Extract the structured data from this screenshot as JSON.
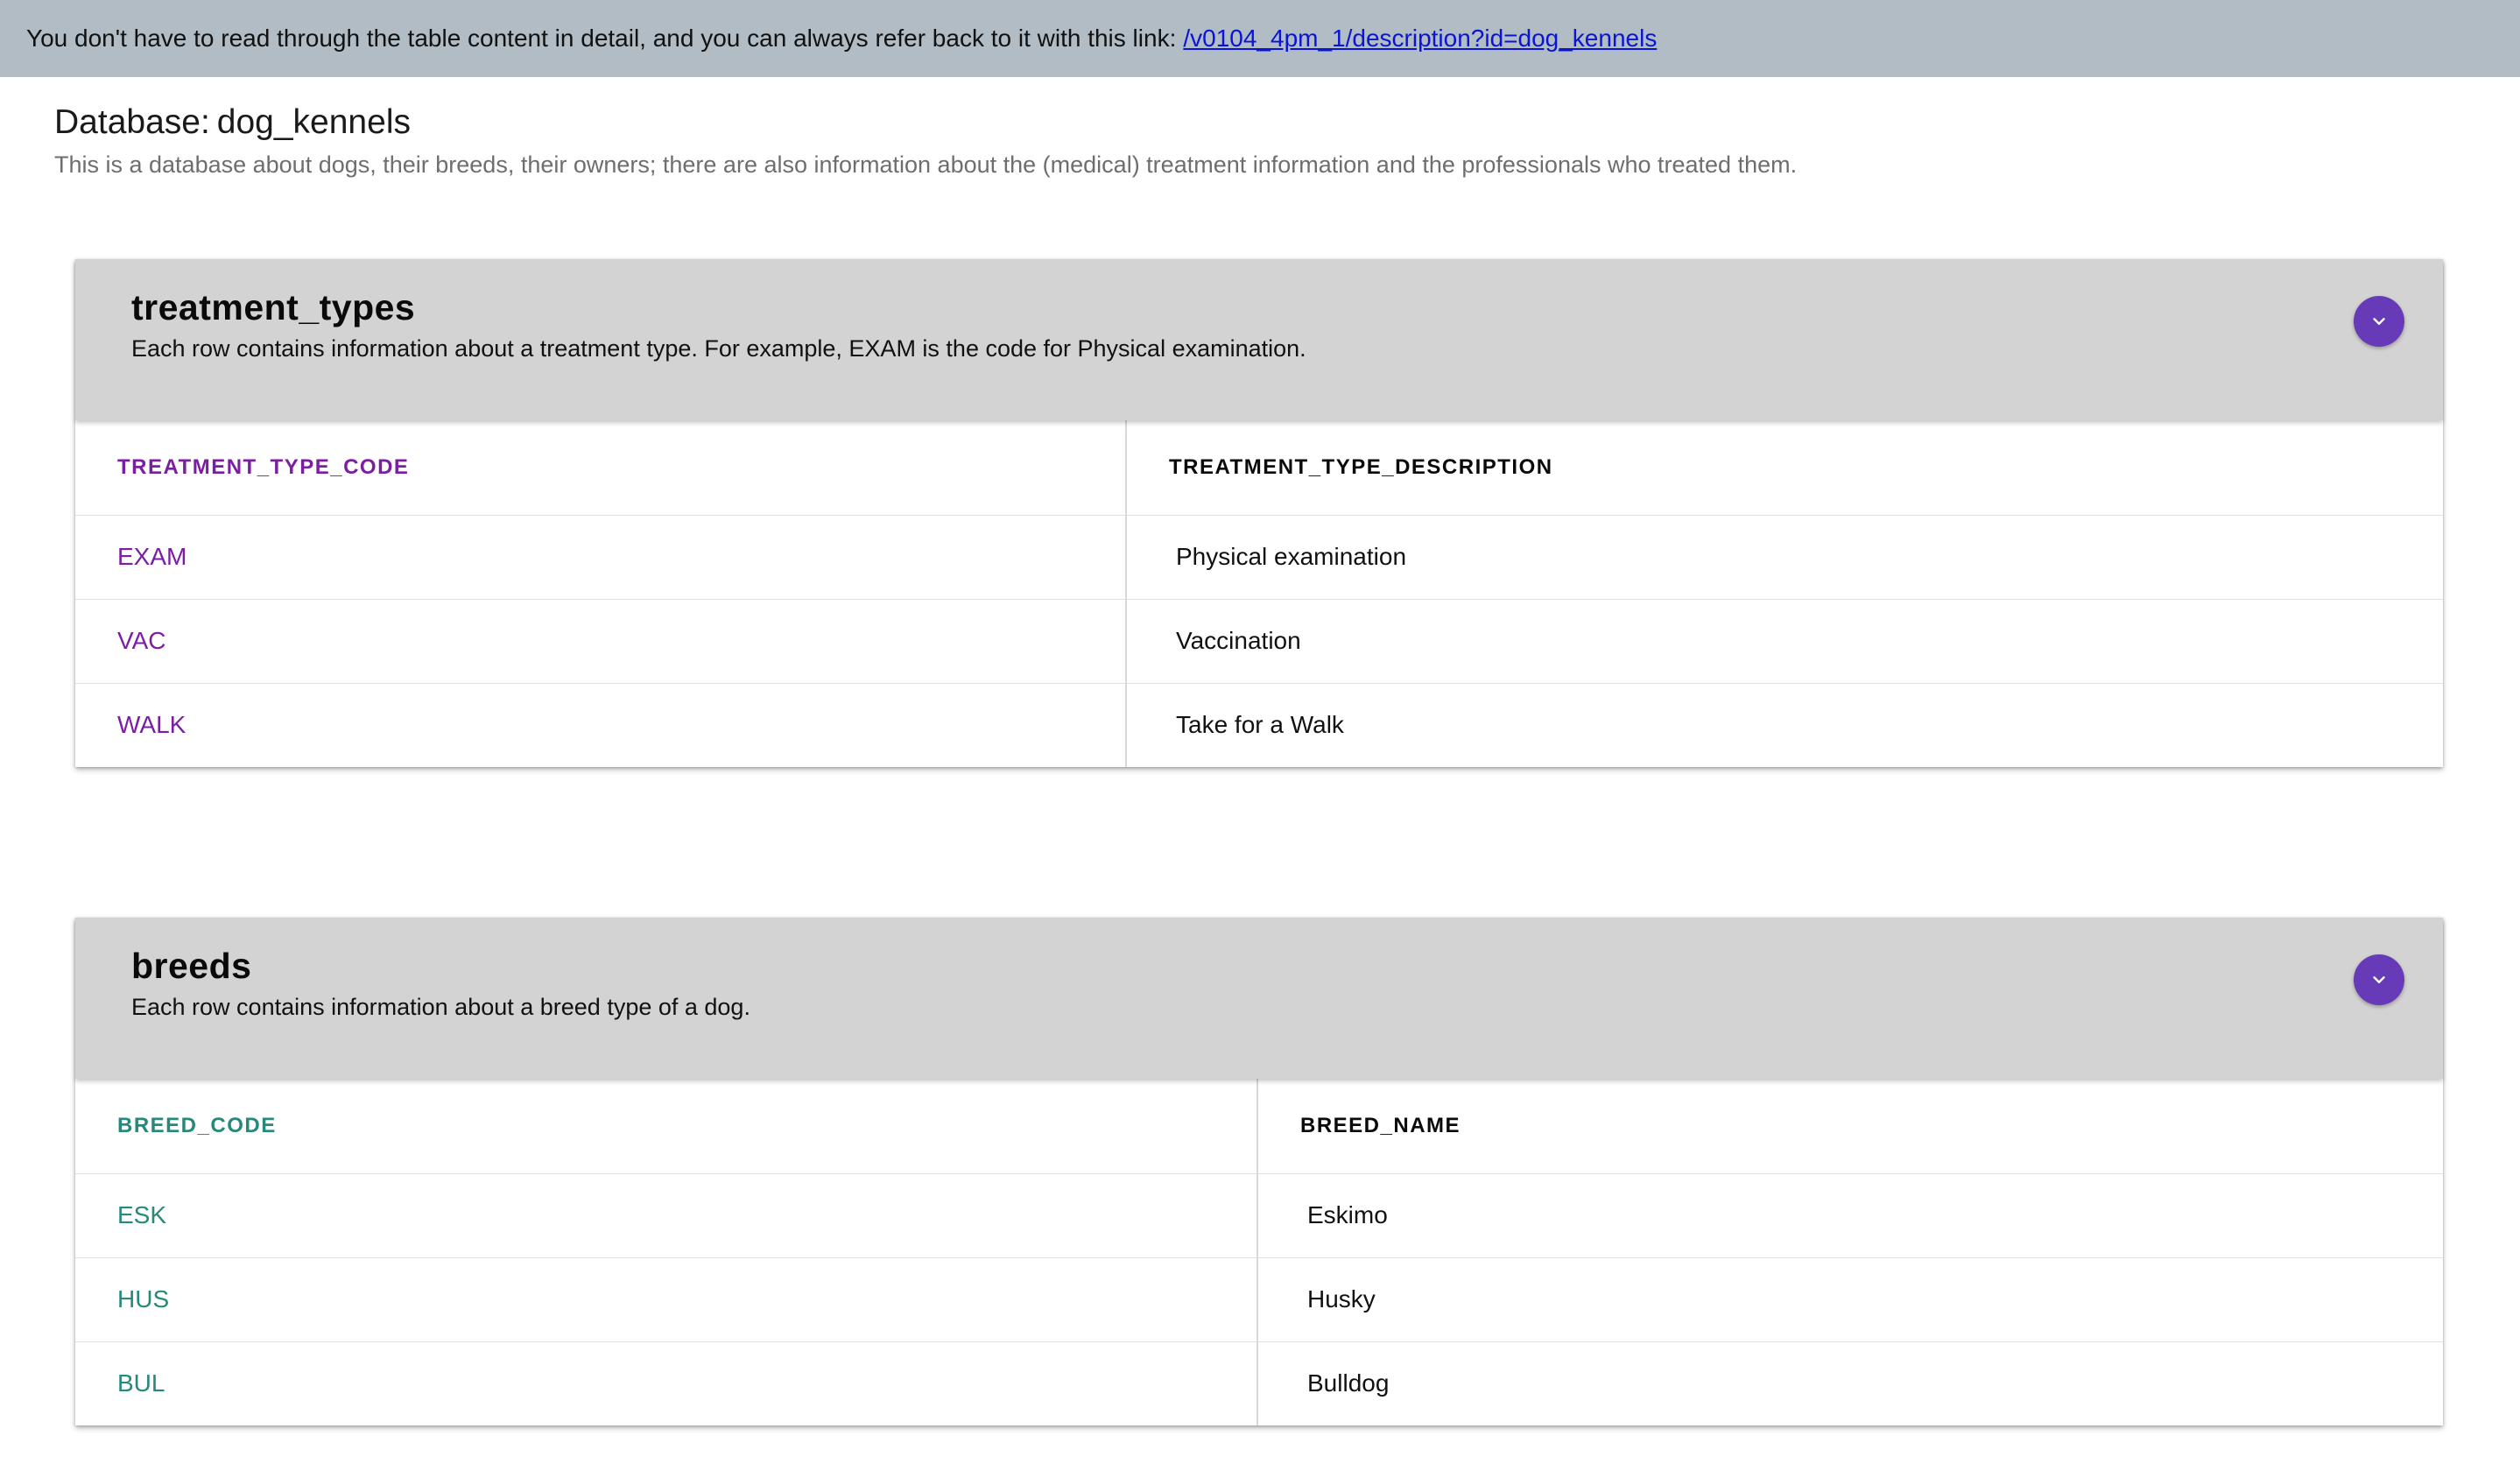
{
  "notice": {
    "text": "You don't have to read through the table content in detail, and you can always refer back to it with this link:",
    "link_text": "/v0104_4pm_1/description?id=dog_kennels"
  },
  "database": {
    "label": "Database:",
    "name": "dog_kennels",
    "description": "This is a database about dogs, their breeds, their owners; there are also information about the (medical) treatment information and the professionals who treated them."
  },
  "tables": [
    {
      "name": "treatment_types",
      "description": "Each row contains information about a treatment type. For example, EXAM is the code for Physical examination.",
      "columns": [
        "TREATMENT_TYPE_CODE",
        "TREATMENT_TYPE_DESCRIPTION"
      ],
      "rows": [
        [
          "EXAM",
          "Physical examination"
        ],
        [
          "VAC",
          "Vaccination"
        ],
        [
          "WALK",
          "Take for a Walk"
        ]
      ]
    },
    {
      "name": "breeds",
      "description": "Each row contains information about a breed type of a dog.",
      "columns": [
        "BREED_CODE",
        "BREED_NAME"
      ],
      "rows": [
        [
          "ESK",
          "Eskimo"
        ],
        [
          "HUS",
          "Husky"
        ],
        [
          "BUL",
          "Bulldog"
        ]
      ]
    }
  ],
  "icons": {
    "expand": "chevron-down-icon"
  },
  "colors": {
    "notice_bg": "#b1bcc4",
    "link": "#0a14d8",
    "card_header_bg": "#d3d3d3",
    "expand_button": "#673ab7",
    "treatment_key_color": "#7b1fa2",
    "breed_key_color": "#26897a"
  }
}
